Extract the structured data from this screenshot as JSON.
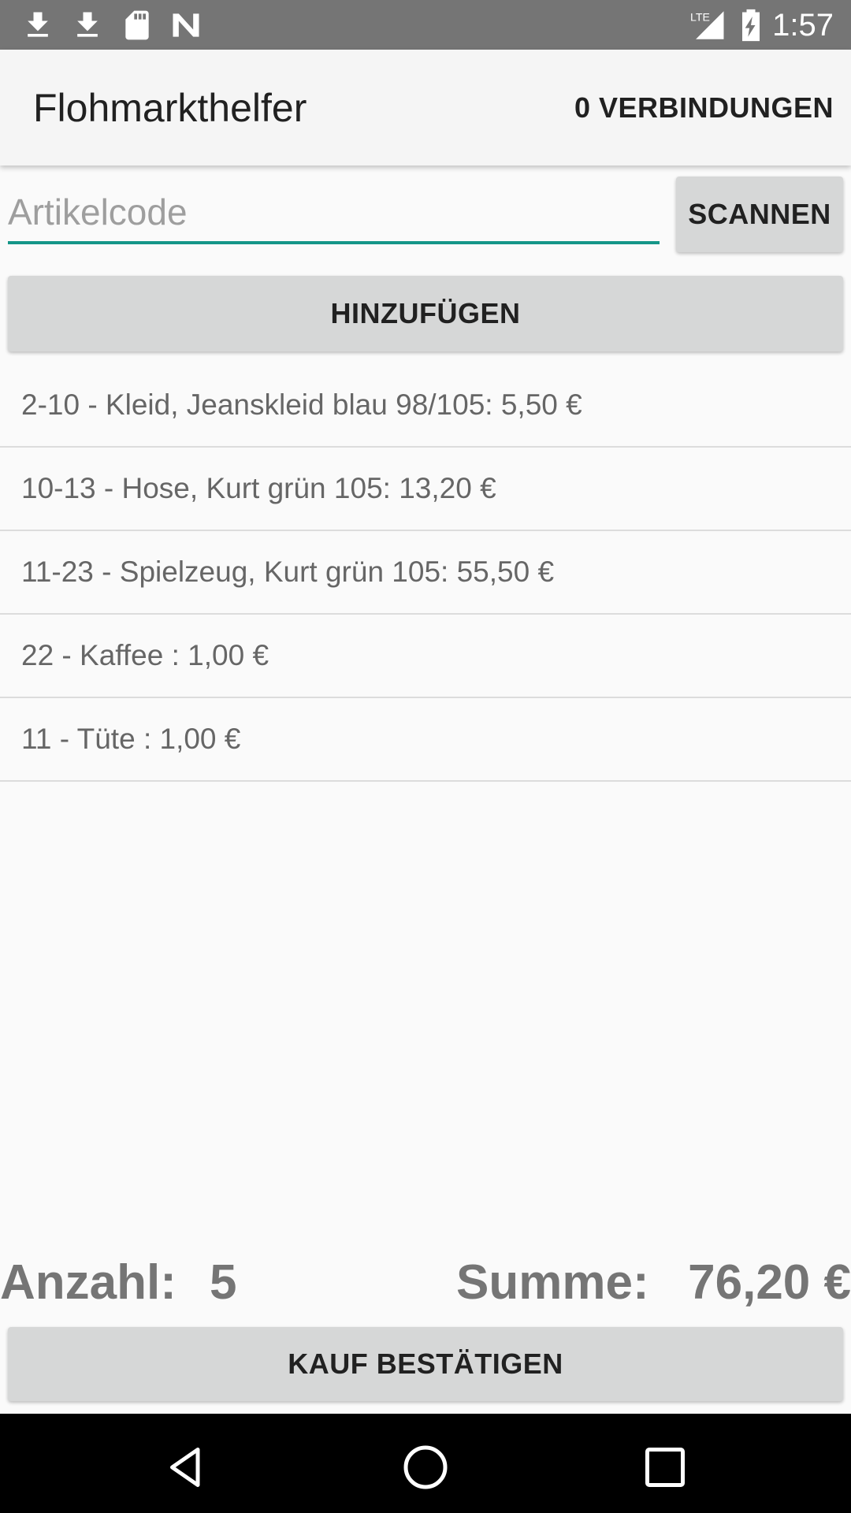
{
  "status_bar": {
    "time": "1:57",
    "icons": [
      "download-icon",
      "download-icon",
      "sd-card-icon",
      "n-logo-icon",
      "lte-signal-icon",
      "battery-charging-icon"
    ],
    "network_label": "LTE"
  },
  "app_bar": {
    "title": "Flohmarkthelfer",
    "action": "0 VERBINDUNGEN"
  },
  "input": {
    "placeholder": "Artikelcode",
    "value": ""
  },
  "buttons": {
    "scan": "SCANNEN",
    "add": "HINZUFÜGEN",
    "confirm": "KAUF BESTÄTIGEN"
  },
  "items": [
    "2-10 - Kleid, Jeanskleid blau 98/105: 5,50 €",
    "10-13 - Hose, Kurt grün 105: 13,20 €",
    "11-23 - Spielzeug, Kurt grün 105: 55,50 €",
    "22 - Kaffee : 1,00 €",
    "11 - Tüte : 1,00 €"
  ],
  "totals": {
    "count_label": "Anzahl:",
    "count_value": "5",
    "sum_label": "Summe:",
    "sum_value": "76,20 €"
  },
  "nav": {
    "icons": [
      "back-icon",
      "home-icon",
      "recents-icon"
    ]
  },
  "colors": {
    "accent": "#159688",
    "status_bar": "#757575",
    "button": "#d6d7d7"
  }
}
